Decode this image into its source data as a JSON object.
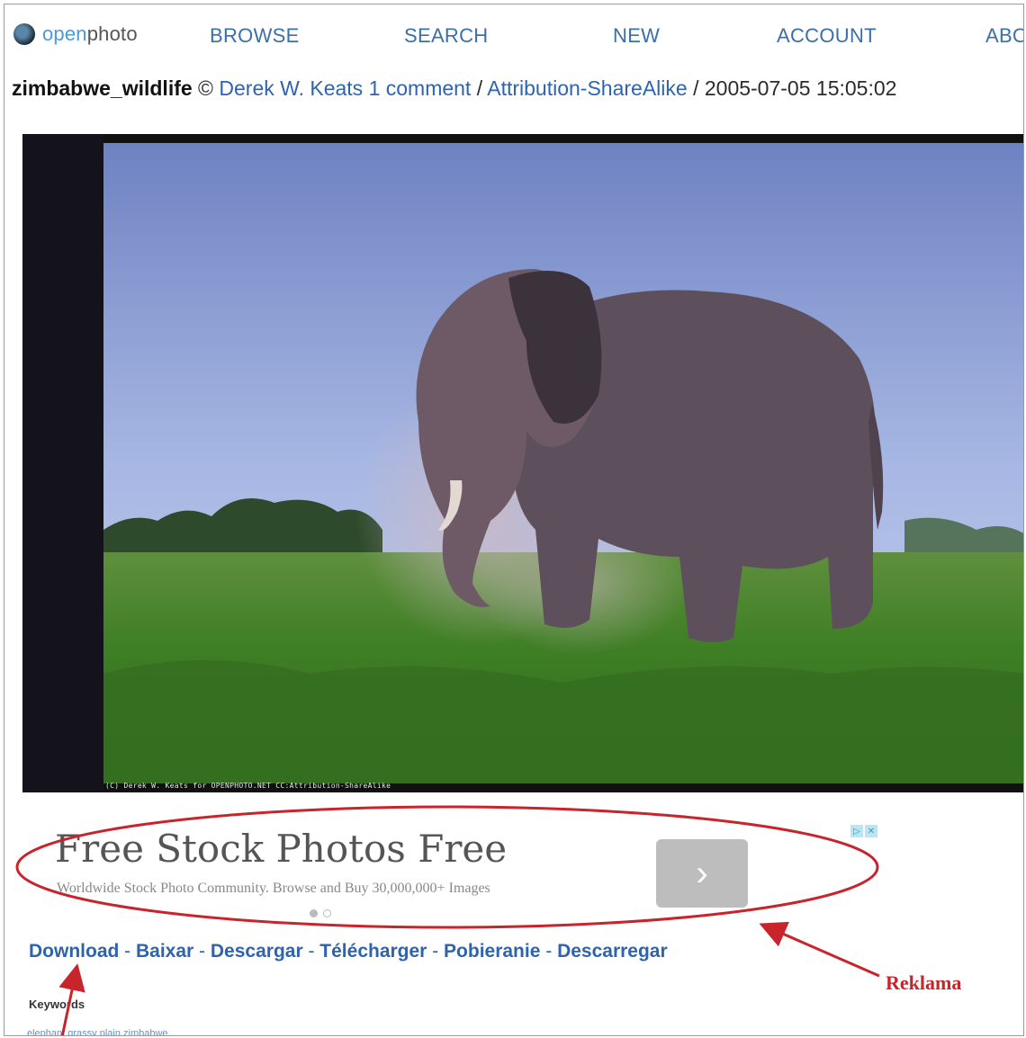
{
  "nav": {
    "logo_open": "open",
    "logo_photo": "photo",
    "items": [
      "BROWSE",
      "SEARCH",
      "NEW",
      "ACCOUNT",
      "ABO"
    ]
  },
  "photo_page": {
    "name": "zimbabwe_wildlife",
    "copyright": "©",
    "author": "Derek W. Keats",
    "comments": "1 comment",
    "slash1": "/",
    "license": "Attribution-ShareAlike",
    "slash2": "/",
    "date": "2005-07-05 15:05:02",
    "credit_overlay": "(C) Derek W. Keats for OPENPHOTO.NET CC:Attribution-ShareAlike"
  },
  "ad": {
    "headline": "Free Stock Photos Free",
    "subtext": "Worldwide Stock Photo Community. Browse and Buy 30,000,000+ Images",
    "button_glyph": "›",
    "adchoices": [
      "▷",
      "✕"
    ]
  },
  "downloads": {
    "links": [
      "Download",
      "Baixar",
      "Descargar",
      "Télécharger",
      "Pobieranie",
      "Descarregar"
    ],
    "separator": " - "
  },
  "keywords": {
    "heading": "Keywords",
    "values": "elephant grassy plain zimbabwe"
  },
  "annotation": {
    "label": "Reklama",
    "color": "#c8242b"
  },
  "colors": {
    "link": "#2e64ad",
    "nav": "#3a6fa8",
    "annotation": "#c8242b"
  }
}
